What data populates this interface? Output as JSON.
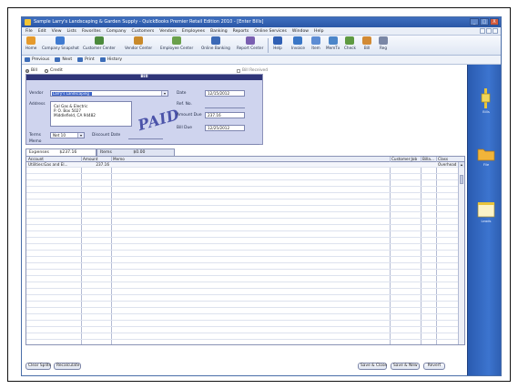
{
  "window": {
    "title": "Sample Larry's Landscaping & Garden Supply - QuickBooks Premier Retail Edition 2010 - [Enter Bills]",
    "buttons": [
      "_",
      "□",
      "X"
    ]
  },
  "menu": [
    "File",
    "Edit",
    "View",
    "Lists",
    "Favorites",
    "Company",
    "Customers",
    "Vendors",
    "Employees",
    "Banking",
    "Reports",
    "Online Services",
    "Window",
    "Help"
  ],
  "iconbar": [
    {
      "label": "Home",
      "icon": "home-icon",
      "color": "#e59a2c"
    },
    {
      "label": "Company Snapshot",
      "icon": "snapshot-icon",
      "color": "#3f7bd1"
    },
    {
      "label": "Customer Center",
      "icon": "customer-center-icon",
      "color": "#4b8a3c"
    },
    {
      "label": "Vendor Center",
      "icon": "vendor-center-icon",
      "color": "#c98a2a"
    },
    {
      "label": "Employee Center",
      "icon": "employee-center-icon",
      "color": "#6aa04b"
    },
    {
      "label": "Online Banking",
      "icon": "online-banking-icon",
      "color": "#3b69b6"
    },
    {
      "label": "Report Center",
      "icon": "report-center-icon",
      "color": "#7a5fb1"
    },
    {
      "label": "Help",
      "icon": "help-icon",
      "color": "#2f5fb4"
    },
    {
      "label": "Invoice",
      "icon": "invoice-icon",
      "color": "#3a77c7"
    },
    {
      "label": "Item",
      "icon": "item-icon",
      "color": "#5c8cd4"
    },
    {
      "label": "MemTx",
      "icon": "memtx-icon",
      "color": "#4c86c9"
    },
    {
      "label": "Check",
      "icon": "check-icon",
      "color": "#5e9a41"
    },
    {
      "label": "Bill",
      "icon": "bill-icon",
      "color": "#d28a34"
    },
    {
      "label": "Reg",
      "icon": "register-icon",
      "color": "#7a87a6"
    }
  ],
  "toolbar": {
    "previous": "Previous",
    "next": "Next",
    "print": "Print",
    "history": "History"
  },
  "form": {
    "radio_bill": "Bill",
    "radio_credit": "Credit",
    "bill_received": "Bill Received",
    "header": "Bill",
    "vendor_label": "Vendor",
    "vendor_value": "Larry's Landscaping",
    "address_label": "Address",
    "address_lines": [
      "Cal Gas & Electric",
      "P. O. Box 5027",
      "Middlefield, CA 94482"
    ],
    "date_label": "Date",
    "date_value": "12/15/2012",
    "refno_label": "Ref. No.",
    "refno_value": "",
    "amount_label": "Amount Due",
    "amount_value": "237.16",
    "billdue_label": "Bill Due",
    "billdue_value": "12/25/2012",
    "terms_label": "Terms",
    "terms_value": "Net 10",
    "discount_label": "Discount Date",
    "memo_label": "Memo",
    "stamp": "PAID"
  },
  "tabs": {
    "expenses_label": "Expenses",
    "expenses_amount": "$237.16",
    "items_label": "Items",
    "items_amount": "$0.00"
  },
  "grid": {
    "columns": [
      "Account",
      "Amount",
      "Memo",
      "Customer:Job",
      "Billa...",
      "Class"
    ],
    "rows": [
      {
        "account": "Utilities:Gas and El...",
        "amount": "237.16",
        "memo": "",
        "customer": "",
        "billable": "",
        "class": "Overhead"
      }
    ]
  },
  "buttons": {
    "clear_splits": "Clear Splits",
    "recalculate": "Recalculate",
    "save_close": "Save & Close",
    "save_new": "Save & New",
    "revert": "Revert"
  },
  "open_windows": [
    "Bills",
    "File",
    "Leads"
  ]
}
